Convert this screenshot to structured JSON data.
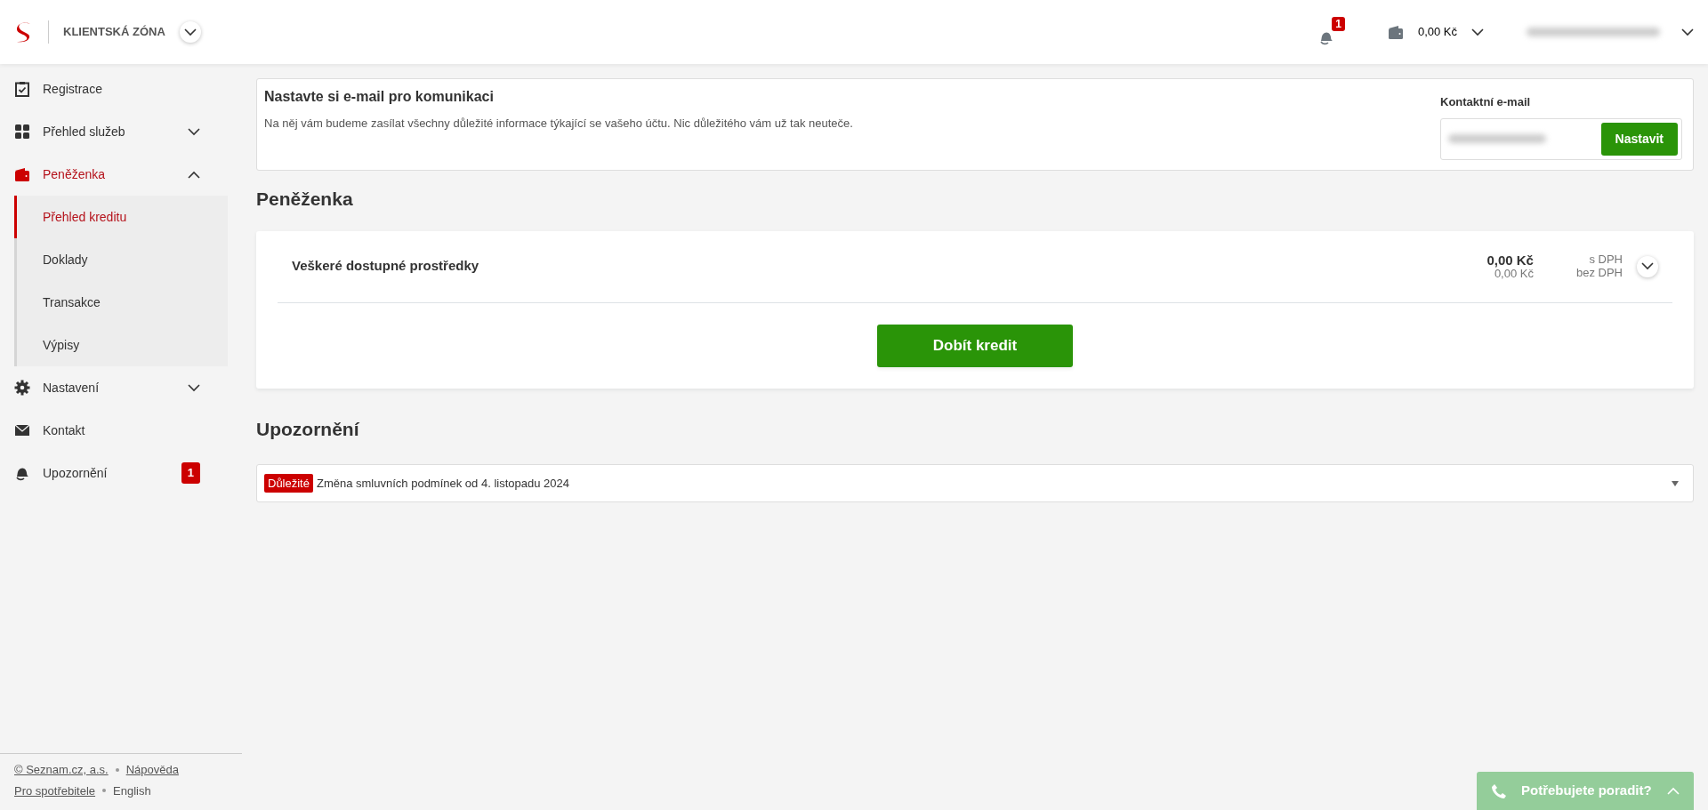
{
  "header": {
    "brand": "KLIENTSKÁ ZÓNA",
    "notification_count": "1",
    "balance": "0,00 Kč"
  },
  "sidebar": {
    "items": [
      {
        "label": "Registrace",
        "kind": "clipboard",
        "selected": false
      },
      {
        "label": "Přehled služeb",
        "kind": "grid",
        "selected": false,
        "expanded": false
      },
      {
        "label": "Peněženka",
        "kind": "wallet",
        "selected": true,
        "expanded": true,
        "children": [
          {
            "label": "Přehled kreditu",
            "selected": true
          },
          {
            "label": "Doklady",
            "selected": false
          },
          {
            "label": "Transakce",
            "selected": false
          },
          {
            "label": "Výpisy",
            "selected": false
          }
        ]
      },
      {
        "label": "Nastavení",
        "kind": "gear",
        "selected": false,
        "expanded": false
      },
      {
        "label": "Kontakt",
        "kind": "envelope",
        "selected": false
      },
      {
        "label": "Upozornění",
        "kind": "bell",
        "selected": false,
        "badge": "1"
      }
    ]
  },
  "email_card": {
    "title": "Nastavte si e-mail pro komunikaci",
    "text": "Na něj vám budeme zasílat všechny důležité informace týkající se vašeho účtu. Nic důležitého vám už tak neuteče.",
    "field_label": "Kontaktní e-mail",
    "button": "Nastavit"
  },
  "wallet": {
    "heading": "Peněženka",
    "label": "Veškeré dostupné prostředky",
    "amount_vat": "0,00 Kč",
    "amount_no_vat": "0,00 Kč",
    "vat_label": "s DPH",
    "no_vat_label": "bez DPH",
    "button": "Dobít kredit"
  },
  "notices": {
    "heading": "Upozornění",
    "items": [
      {
        "tag": "Důležité",
        "text": "Změna smluvních podmínek od 4. listopadu 2024",
        "expanded": false
      }
    ]
  },
  "footer": {
    "links": [
      {
        "label": "© Seznam.cz, a.s.",
        "underlined": true
      },
      {
        "label": "Nápověda",
        "underlined": true
      },
      {
        "label": "Pro spotřebitele",
        "underlined": true
      },
      {
        "label": "English",
        "underlined": false
      }
    ]
  },
  "help_button": {
    "label": "Potřebujete poradit?",
    "expanded": false
  }
}
